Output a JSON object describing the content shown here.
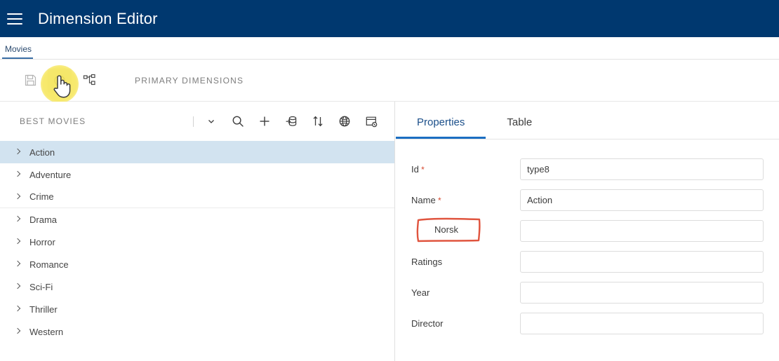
{
  "header": {
    "title": "Dimension Editor",
    "menu_icon": "hamburger-icon"
  },
  "breadcrumb": {
    "items": [
      {
        "label": "Movies",
        "active": true
      }
    ]
  },
  "toolbar": {
    "caption": "PRIMARY DIMENSIONS",
    "buttons": [
      {
        "name": "save-button",
        "icon": "floppy-disk-icon",
        "state": "disabled"
      },
      {
        "name": "refresh-button",
        "icon": "circular-arrow-icon",
        "state": "hovered"
      },
      {
        "name": "hierarchy-button",
        "icon": "hierarchy-icon",
        "state": "default"
      }
    ]
  },
  "tree_panel": {
    "title": "BEST MOVIES",
    "actions": [
      {
        "name": "dropdown-toggle",
        "icon": "chevron-down-icon"
      },
      {
        "name": "search-button",
        "icon": "search-icon"
      },
      {
        "name": "add-button",
        "icon": "plus-icon"
      },
      {
        "name": "import-button",
        "icon": "database-import-icon"
      },
      {
        "name": "sort-button",
        "icon": "sort-arrows-icon"
      },
      {
        "name": "translate-button",
        "icon": "globe-icon"
      },
      {
        "name": "delete-card-button",
        "icon": "card-remove-icon"
      }
    ],
    "items": [
      {
        "label": "Action",
        "selected": true,
        "rule": false
      },
      {
        "label": "Adventure",
        "selected": false,
        "rule": false
      },
      {
        "label": "Crime",
        "selected": false,
        "rule": true
      },
      {
        "label": "Drama",
        "selected": false,
        "rule": false
      },
      {
        "label": "Horror",
        "selected": false,
        "rule": false
      },
      {
        "label": "Romance",
        "selected": false,
        "rule": false
      },
      {
        "label": "Sci-Fi",
        "selected": false,
        "rule": false
      },
      {
        "label": "Thriller",
        "selected": false,
        "rule": false
      },
      {
        "label": "Western",
        "selected": false,
        "rule": false
      }
    ]
  },
  "properties_panel": {
    "tabs": [
      {
        "label": "Properties",
        "active": true
      },
      {
        "label": "Table",
        "active": false
      }
    ],
    "fields": [
      {
        "label": "Id",
        "required": true,
        "value": "type8",
        "placeholder": ""
      },
      {
        "label": "Name",
        "required": true,
        "value": "Action",
        "placeholder": ""
      },
      {
        "label": "Norsk",
        "required": false,
        "value": "",
        "placeholder": "",
        "annotated": true
      },
      {
        "label": "Ratings",
        "required": false,
        "value": "",
        "placeholder": ""
      },
      {
        "label": "Year",
        "required": false,
        "value": "",
        "placeholder": ""
      },
      {
        "label": "Director",
        "required": false,
        "value": "",
        "placeholder": ""
      }
    ]
  },
  "colors": {
    "header_blue": "#00386f",
    "selected_row": "#d2e3f0",
    "tab_accent": "#1b6ec2",
    "required_star": "#d6492f",
    "annotation_red": "#e0553f",
    "click_highlight": "#f6e65a"
  }
}
